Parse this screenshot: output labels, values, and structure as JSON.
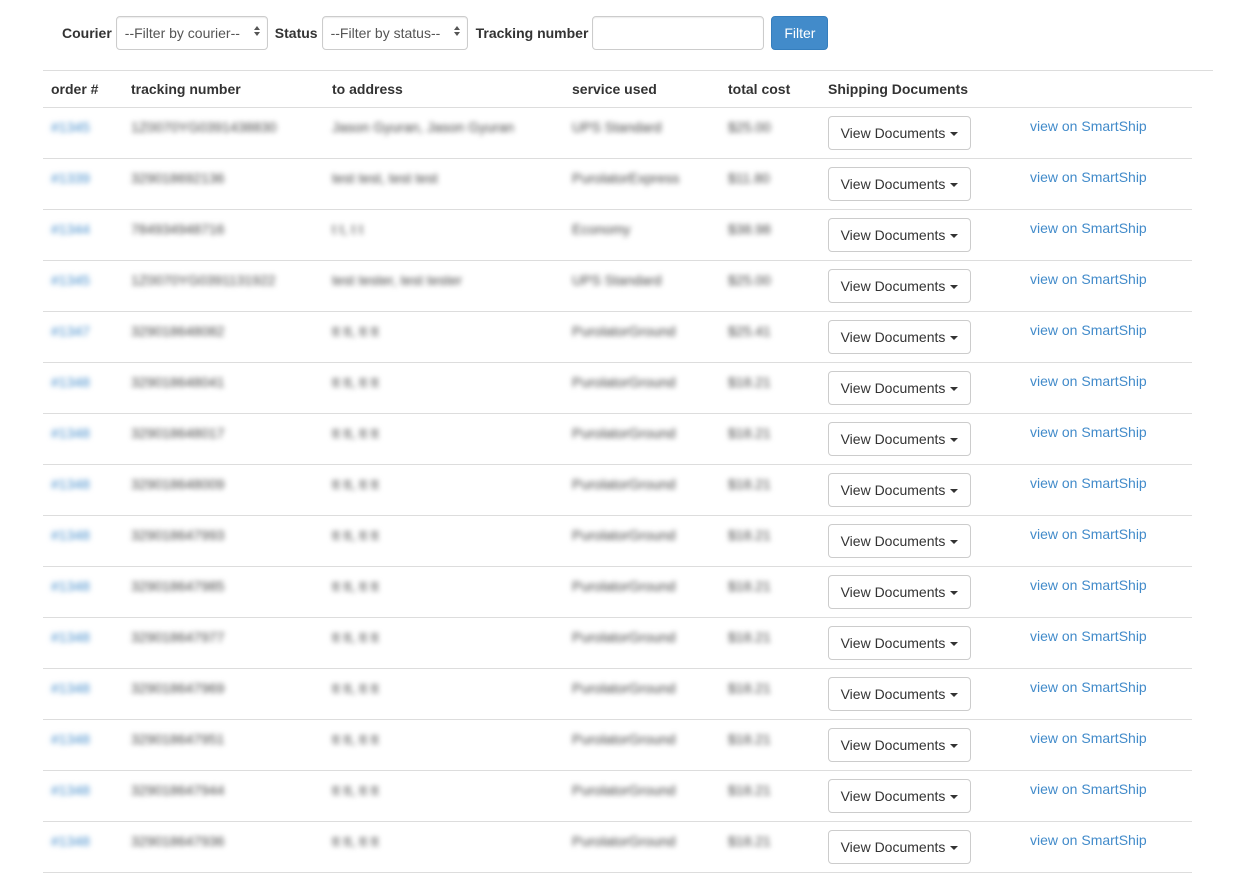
{
  "filters": {
    "courier_label": "Courier",
    "courier_value": "--Filter by courier--",
    "status_label": "Status",
    "status_value": "--Filter by status--",
    "tracking_label": "Tracking number",
    "tracking_value": "",
    "filter_button": "Filter"
  },
  "table": {
    "headers": [
      "order #",
      "tracking number",
      "to address",
      "service used",
      "total cost",
      "Shipping Documents",
      ""
    ],
    "docs_button_label": "View Documents",
    "smartship_link_label": "view on SmartShip",
    "rows": [
      {
        "order": "#1345",
        "tracking": "1Z0070YG0391438830",
        "address": "Jason Gyuran, Jason Gyuran",
        "service": "UPS Standard",
        "cost": "$25.00"
      },
      {
        "order": "#1339",
        "tracking": "329018692136",
        "address": "test test, test test",
        "service": "PurolatorExpress",
        "cost": "$11.80"
      },
      {
        "order": "#1344",
        "tracking": "784934948716",
        "address": "t t, t t",
        "service": "Economy",
        "cost": "$38.98"
      },
      {
        "order": "#1345",
        "tracking": "1Z0070YG0391131922",
        "address": "test tester, test tester",
        "service": "UPS Standard",
        "cost": "$25.00"
      },
      {
        "order": "#1347",
        "tracking": "329018648082",
        "address": "tt tt, tt tt",
        "service": "PurolatorGround",
        "cost": "$25.41"
      },
      {
        "order": "#1348",
        "tracking": "329018648041",
        "address": "tt tt, tt tt",
        "service": "PurolatorGround",
        "cost": "$18.21"
      },
      {
        "order": "#1348",
        "tracking": "329018648017",
        "address": "tt tt, tt tt",
        "service": "PurolatorGround",
        "cost": "$18.21"
      },
      {
        "order": "#1348",
        "tracking": "329018648009",
        "address": "tt tt, tt tt",
        "service": "PurolatorGround",
        "cost": "$18.21"
      },
      {
        "order": "#1348",
        "tracking": "329018647993",
        "address": "tt tt, tt tt",
        "service": "PurolatorGround",
        "cost": "$18.21"
      },
      {
        "order": "#1348",
        "tracking": "329018647985",
        "address": "tt tt, tt tt",
        "service": "PurolatorGround",
        "cost": "$18.21"
      },
      {
        "order": "#1348",
        "tracking": "329018647977",
        "address": "tt tt, tt tt",
        "service": "PurolatorGround",
        "cost": "$18.21"
      },
      {
        "order": "#1348",
        "tracking": "329018647969",
        "address": "tt tt, tt tt",
        "service": "PurolatorGround",
        "cost": "$18.21"
      },
      {
        "order": "#1348",
        "tracking": "329018647951",
        "address": "tt tt, tt tt",
        "service": "PurolatorGround",
        "cost": "$18.21"
      },
      {
        "order": "#1348",
        "tracking": "329018647944",
        "address": "tt tt, tt tt",
        "service": "PurolatorGround",
        "cost": "$18.21"
      },
      {
        "order": "#1348",
        "tracking": "329018647936",
        "address": "tt tt, tt tt",
        "service": "PurolatorGround",
        "cost": "$18.21"
      }
    ]
  },
  "colors": {
    "link": "#428bca",
    "primary_button": "#428bca",
    "border": "#dddddd"
  }
}
